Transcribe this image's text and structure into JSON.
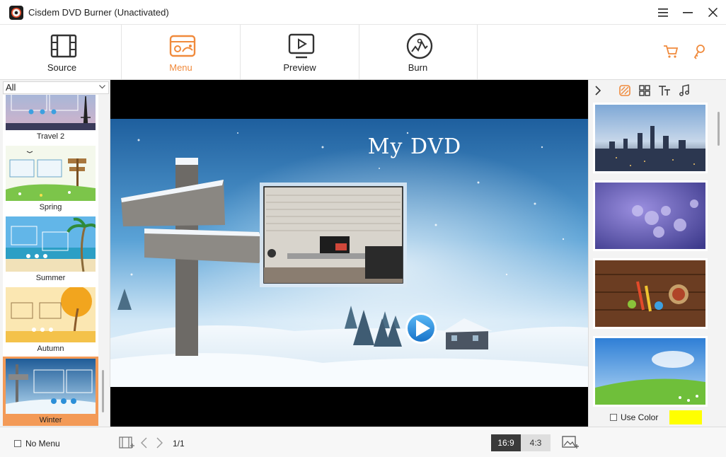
{
  "window": {
    "title": "Cisdem DVD Burner (Unactivated)",
    "controls": [
      "menu",
      "minimize",
      "close"
    ]
  },
  "toolbar": {
    "tabs": [
      {
        "label": "Source",
        "icon": "film-icon",
        "active": false
      },
      {
        "label": "Menu",
        "icon": "menu-template-icon",
        "active": true
      },
      {
        "label": "Preview",
        "icon": "preview-icon",
        "active": false
      },
      {
        "label": "Burn",
        "icon": "burn-disc-icon",
        "active": false
      }
    ],
    "right_icons": [
      "cart-icon",
      "key-icon"
    ],
    "accent": "#f08a3c"
  },
  "themes": {
    "filter": "All",
    "items": [
      {
        "label": "Travel 2"
      },
      {
        "label": "Spring"
      },
      {
        "label": "Summer"
      },
      {
        "label": "Autumn"
      },
      {
        "label": "Winter",
        "selected": true
      }
    ]
  },
  "preview": {
    "title": "My DVD"
  },
  "rightpanel": {
    "tabs": [
      "collapse-chevron-icon",
      "background-icon",
      "layout-icon",
      "text-icon",
      "music-icon"
    ],
    "backgrounds": [
      "City skyline",
      "Purple flowers",
      "Wood with spices",
      "Green meadow"
    ],
    "use_color_label": "Use Color",
    "color": "#ffff00"
  },
  "bottom": {
    "no_menu_label": "No Menu",
    "page": "1/1",
    "ratio_active": "16:9",
    "ratio_other": "4:3"
  }
}
